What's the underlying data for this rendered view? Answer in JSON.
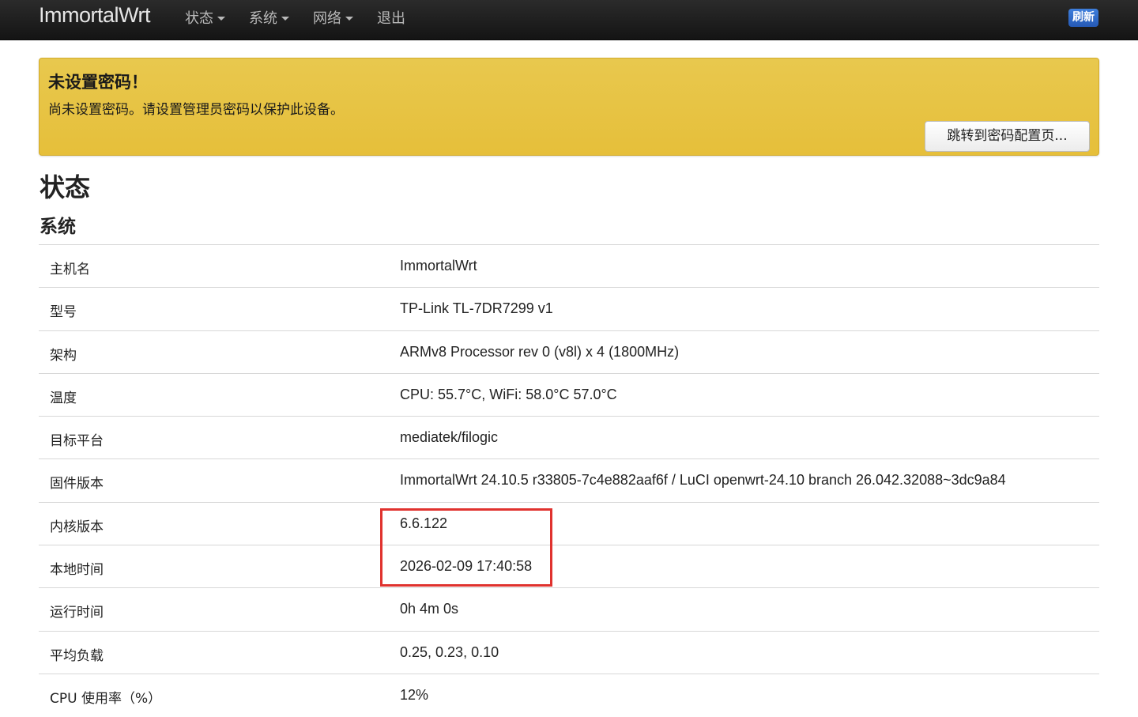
{
  "navbar": {
    "brand": "ImmortalWrt",
    "menu": [
      {
        "label": "状态",
        "has_caret": true
      },
      {
        "label": "系统",
        "has_caret": true
      },
      {
        "label": "网络",
        "has_caret": true
      },
      {
        "label": "退出",
        "has_caret": false
      }
    ],
    "refresh_label": "刷新"
  },
  "alert": {
    "title": "未设置密码！",
    "message": "尚未设置密码。请设置管理员密码以保护此设备。",
    "button_label": "跳转到密码配置页..."
  },
  "page": {
    "title": "状态",
    "section_title": "系统"
  },
  "system": {
    "rows": [
      {
        "label": "主机名",
        "value": "ImmortalWrt"
      },
      {
        "label": "型号",
        "value": "TP-Link TL-7DR7299 v1"
      },
      {
        "label": "架构",
        "value": "ARMv8 Processor rev 0 (v8l) x 4 (1800MHz)"
      },
      {
        "label": "温度",
        "value": "CPU: 55.7°C, WiFi: 58.0°C 57.0°C"
      },
      {
        "label": "目标平台",
        "value": "mediatek/filogic"
      },
      {
        "label": "固件版本",
        "value": "ImmortalWrt 24.10.5 r33805-7c4e882aaf6f / LuCI openwrt-24.10 branch 26.042.32088~3dc9a84"
      },
      {
        "label": "内核版本",
        "value": "6.6.122"
      },
      {
        "label": "本地时间",
        "value": "2026-02-09 17:40:58"
      },
      {
        "label": "运行时间",
        "value": "0h 4m 0s"
      },
      {
        "label": "平均负载",
        "value": "0.25, 0.23, 0.10"
      },
      {
        "label": "CPU 使用率（%）",
        "value": "12%"
      }
    ]
  },
  "colors": {
    "navbar_bg": "#1c1c1c",
    "alert_bg": "#e6bf3a",
    "refresh_badge": "#2f6bd0",
    "highlight": "#e0322e"
  }
}
